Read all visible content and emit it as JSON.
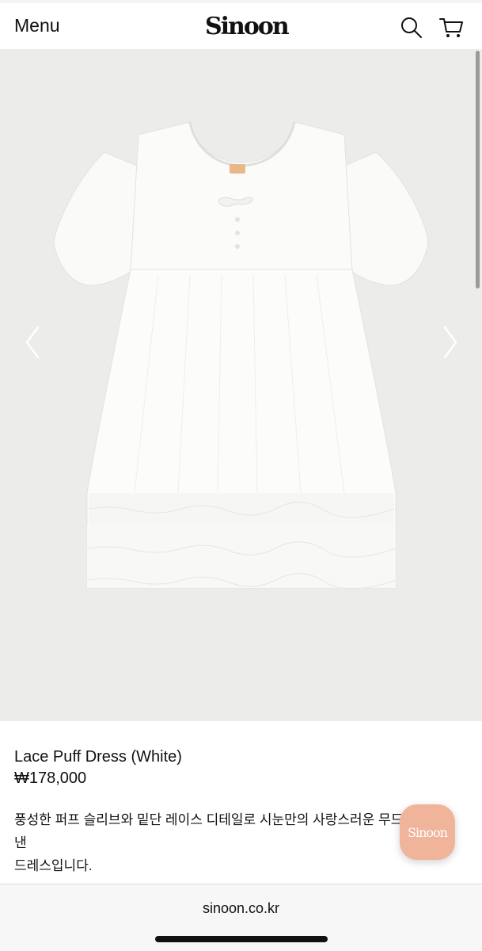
{
  "header": {
    "menu_label": "Menu",
    "logo_text": "Sinoon",
    "search_icon": "search-icon",
    "cart_icon": "cart-icon"
  },
  "gallery": {
    "prev_icon": "chevron-left-icon",
    "next_icon": "chevron-right-icon",
    "background_color": "#ececeb"
  },
  "product": {
    "name": "Lace Puff Dress (White)",
    "price": "₩178,000",
    "description_lines": [
      "풍성한 퍼프 슬리브와 밑단 레이스 디테일로 시눈만의 사랑스러운 무드를",
      "낸",
      "드레스입니다."
    ]
  },
  "chat_button": {
    "label": "Sinoon",
    "color": "#f0b49a"
  },
  "browser": {
    "url": "sinoon.co.kr"
  }
}
